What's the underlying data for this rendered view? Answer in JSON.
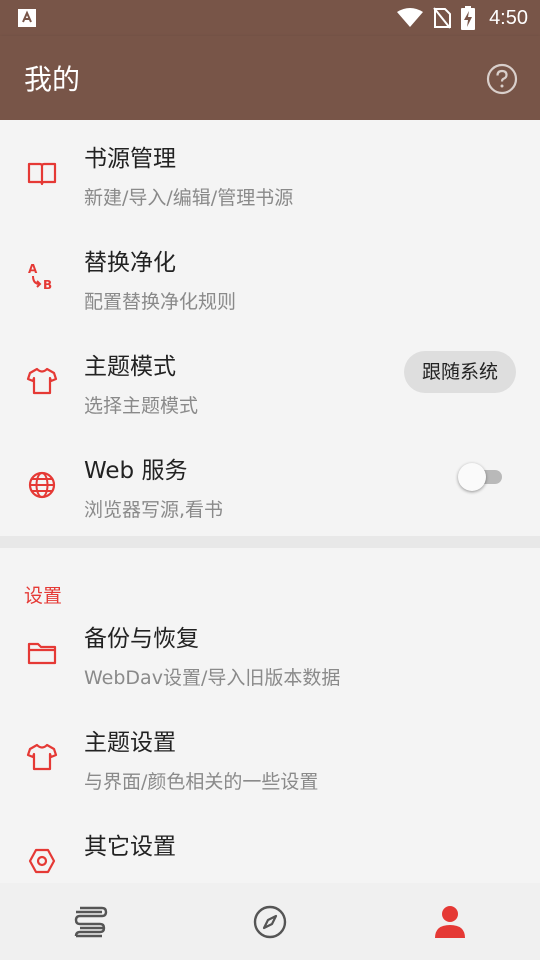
{
  "status_bar": {
    "time": "4:50",
    "icons": [
      "app-notification-icon",
      "wifi-icon",
      "no-sim-icon",
      "battery-charging-icon"
    ]
  },
  "app_bar": {
    "title": "我的",
    "help_icon": "help-circle-icon"
  },
  "main_items": [
    {
      "icon": "book-icon",
      "title": "书源管理",
      "subtitle": "新建/导入/编辑/管理书源"
    },
    {
      "icon": "replace-ab-icon",
      "title": "替换净化",
      "subtitle": "配置替换净化规则"
    },
    {
      "icon": "shirt-icon",
      "title": "主题模式",
      "subtitle": "选择主题模式",
      "chip": "跟随系统"
    },
    {
      "icon": "globe-icon",
      "title": "Web 服务",
      "subtitle": "浏览器写源,看书",
      "toggle_on": false
    }
  ],
  "settings_group": {
    "title": "设置",
    "items": [
      {
        "icon": "folder-icon",
        "title": "备份与恢复",
        "subtitle": "WebDav设置/导入旧版本数据"
      },
      {
        "icon": "shirt-icon",
        "title": "主题设置",
        "subtitle": "与界面/颜色相关的一些设置"
      },
      {
        "icon": "hexagon-settings-icon",
        "title": "其它设置",
        "subtitle": ""
      }
    ]
  },
  "bottom_nav": [
    {
      "icon": "bookshelf-icon",
      "active": false
    },
    {
      "icon": "compass-icon",
      "active": false
    },
    {
      "icon": "person-icon",
      "active": true
    }
  ],
  "colors": {
    "primary": "#785548",
    "accent": "#e53935",
    "background": "#f4f4f4"
  }
}
